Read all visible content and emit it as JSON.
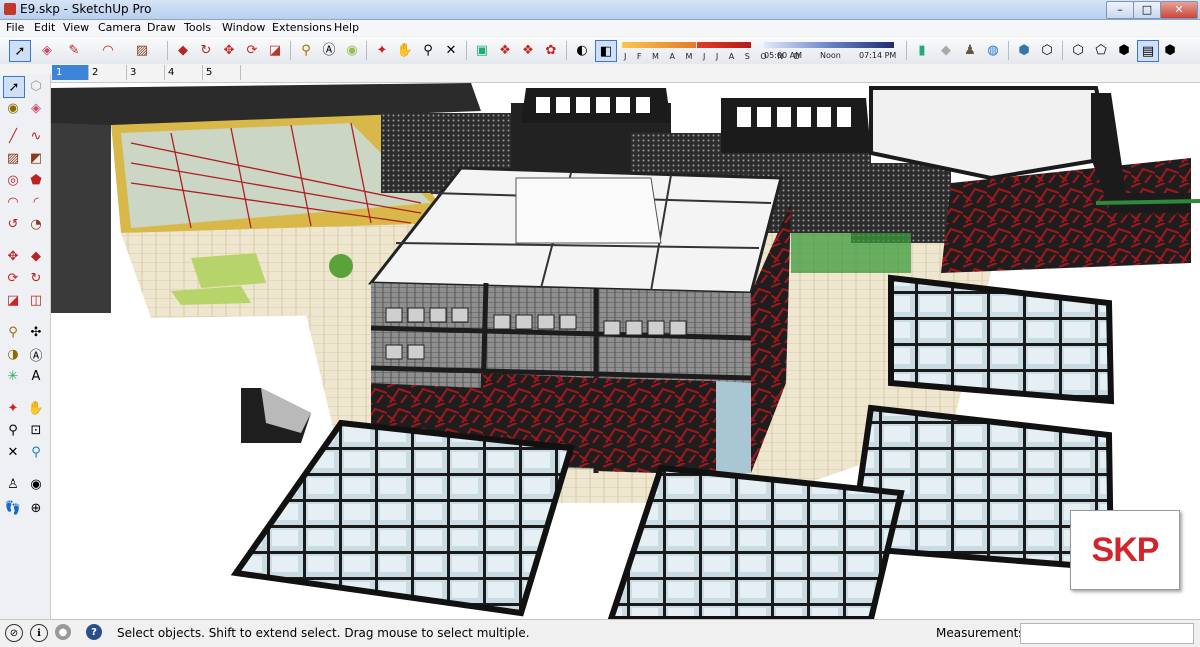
{
  "window": {
    "title": "E9.skp - SketchUp Pro",
    "min": "–",
    "max": "□",
    "close": "✕"
  },
  "menu": [
    "File",
    "Edit",
    "View",
    "Camera",
    "Draw",
    "Tools",
    "Window",
    "Extensions",
    "Help"
  ],
  "shadows": {
    "months": "J F M A M J J A S O N D",
    "time_start": "05:00 AM",
    "time_mid": "Noon",
    "time_end": "07:14 PM"
  },
  "scenes": [
    "1",
    "2",
    "3",
    "4",
    "5"
  ],
  "status": {
    "hint": "Select objects. Shift to extend select. Drag mouse to select multiple.",
    "measurements_label": "Measurements",
    "measurements_value": ""
  },
  "watermark": "SKP",
  "colors": {
    "accent": "#3b84d8",
    "watermark_red": "#d3252c"
  },
  "icons": {
    "toolbar": [
      "select-icon",
      "eraser-icon",
      "pencil-icon",
      "arc-icon",
      "shape-icon",
      "push-pull-icon",
      "follow-me-icon",
      "move-icon",
      "rotate-icon",
      "tape-measure-icon",
      "text-icon",
      "paint-bucket-icon",
      "orbit-icon",
      "pan-icon",
      "zoom-icon",
      "zoom-extents-icon",
      "components-icon",
      "3d-warehouse-icon",
      "extension-icon",
      "shadows-icon",
      "fog-icon",
      "scenes-icon",
      "styles-icon",
      "walk-icon",
      "geo-location-icon",
      "iso-view-icon",
      "top-view-icon",
      "front-view-icon",
      "right-view-icon",
      "back-view-icon",
      "left-view-icon",
      "x-ray-icon",
      "monochrome-icon"
    ],
    "left": [
      "select-icon",
      "component-icon",
      "paint-icon",
      "eraser-icon",
      "line-icon",
      "freehand-icon",
      "rectangle-icon",
      "rotated-rect-icon",
      "circle-icon",
      "polygon-icon",
      "arc-icon",
      "pie-icon",
      "move-icon",
      "push-pull-icon",
      "rotate-icon",
      "follow-me-icon",
      "scale-icon",
      "offset-icon",
      "tape-icon",
      "dimension-icon",
      "protractor-icon",
      "text-icon",
      "axes-icon",
      "3d-text-icon",
      "orbit-icon",
      "pan-icon",
      "zoom-icon",
      "zoom-window-icon",
      "zoom-extents-icon",
      "previous-view-icon",
      "position-camera-icon",
      "look-around-icon",
      "walk-icon",
      "section-plane-icon"
    ]
  }
}
